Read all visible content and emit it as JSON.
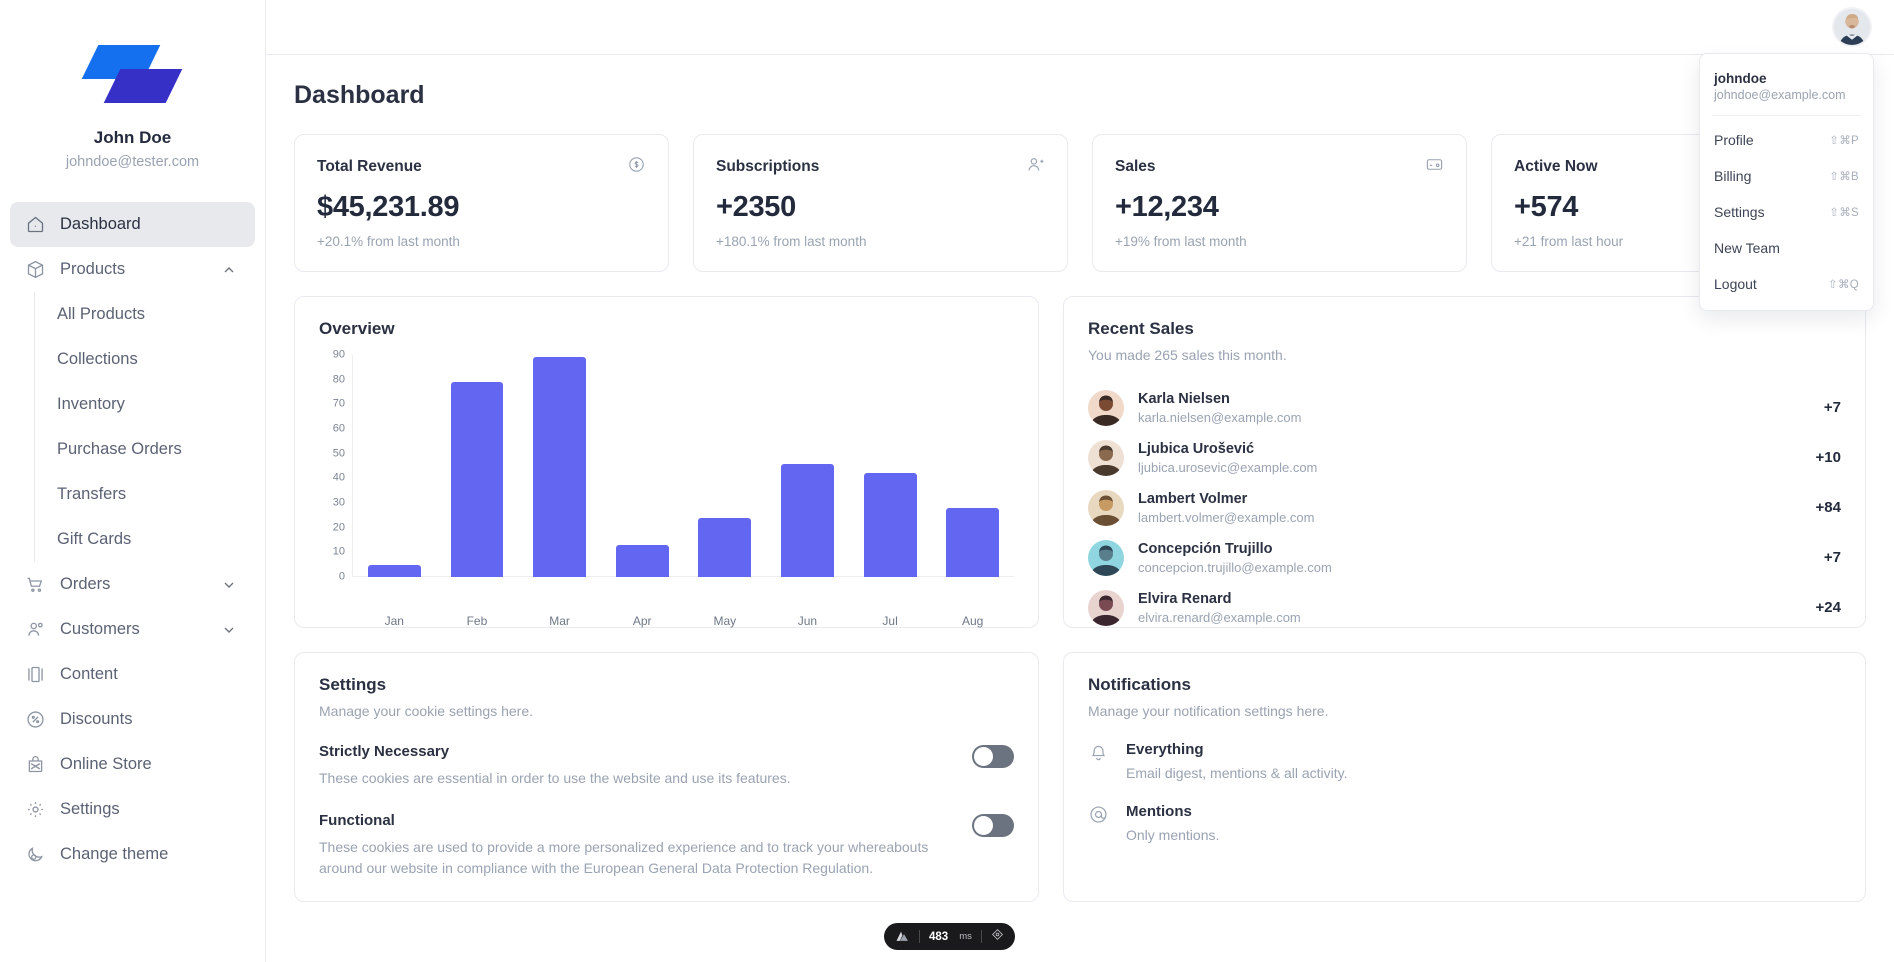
{
  "sidebar": {
    "logo_name": "app-logo",
    "profile": {
      "name": "John Doe",
      "email": "johndoe@tester.com"
    },
    "items": [
      {
        "label": "Dashboard",
        "icon": "home-icon",
        "active": true
      },
      {
        "label": "Products",
        "icon": "box-icon",
        "expanded": true
      },
      {
        "label": "Orders",
        "icon": "cart-icon",
        "expanded": false
      },
      {
        "label": "Customers",
        "icon": "users-icon",
        "expanded": false
      },
      {
        "label": "Content",
        "icon": "content-icon"
      },
      {
        "label": "Discounts",
        "icon": "discount-icon"
      },
      {
        "label": "Online Store",
        "icon": "store-icon"
      },
      {
        "label": "Settings",
        "icon": "gear-icon"
      },
      {
        "label": "Change theme",
        "icon": "theme-icon"
      }
    ],
    "products_sub": [
      "All Products",
      "Collections",
      "Inventory",
      "Purchase Orders",
      "Transfers",
      "Gift Cards"
    ]
  },
  "header": {
    "title": "Dashboard",
    "menu_icon": "hamburger-icon",
    "avatar": "user-avatar"
  },
  "stats": [
    {
      "title": "Total Revenue",
      "value": "$45,231.89",
      "sub": "+20.1% from last month",
      "icon": "dollar-icon"
    },
    {
      "title": "Subscriptions",
      "value": "+2350",
      "sub": "+180.1% from last month",
      "icon": "user-plus-icon"
    },
    {
      "title": "Sales",
      "value": "+12,234",
      "sub": "+19% from last month",
      "icon": "credit-card-icon"
    },
    {
      "title": "Active Now",
      "value": "+574",
      "sub": "+21 from last hour",
      "icon": "activity-icon"
    }
  ],
  "overview": {
    "title": "Overview"
  },
  "chart_data": {
    "type": "bar",
    "title": "Overview",
    "categories": [
      "Jan",
      "Feb",
      "Mar",
      "Apr",
      "May",
      "Jun",
      "Jul",
      "Aug"
    ],
    "values": [
      5,
      79,
      89,
      13,
      24,
      46,
      42,
      28
    ],
    "xlabel": "",
    "ylabel": "",
    "ylim": [
      0,
      90
    ],
    "yticks": [
      90,
      80,
      70,
      60,
      50,
      40,
      30,
      20,
      10,
      0
    ],
    "grid": false,
    "legend": false,
    "bar_color": "#6366f1"
  },
  "recent_sales": {
    "title": "Recent Sales",
    "subtitle": "You made 265 sales this month.",
    "rows": [
      {
        "name": "Karla Nielsen",
        "email": "karla.nielsen@example.com",
        "amount": "+7"
      },
      {
        "name": "Ljubica Urošević",
        "email": "ljubica.urosevic@example.com",
        "amount": "+10"
      },
      {
        "name": "Lambert Volmer",
        "email": "lambert.volmer@example.com",
        "amount": "+84"
      },
      {
        "name": "Concepción Trujillo",
        "email": "concepcion.trujillo@example.com",
        "amount": "+7"
      },
      {
        "name": "Elvira Renard",
        "email": "elvira.renard@example.com",
        "amount": "+24"
      }
    ]
  },
  "settings_panel": {
    "title": "Settings",
    "subtitle": "Manage your cookie settings here.",
    "items": [
      {
        "name": "Strictly Necessary",
        "desc": "These cookies are essential in order to use the website and use its features.",
        "enabled": false
      },
      {
        "name": "Functional",
        "desc": "These cookies are used to provide a more personalized experience and to track your whereabouts around our website in compliance with the European General Data Protection Regulation.",
        "enabled": false
      }
    ]
  },
  "notifications_panel": {
    "title": "Notifications",
    "subtitle": "Manage your notification settings here.",
    "items": [
      {
        "name": "Everything",
        "desc": "Email digest, mentions & all activity.",
        "icon": "bell-icon"
      },
      {
        "name": "Mentions",
        "desc": "Only mentions.",
        "icon": "at-icon"
      }
    ]
  },
  "dropdown": {
    "username": "johndoe",
    "email": "johndoe@example.com",
    "items": [
      {
        "label": "Profile",
        "shortcut": "⇧⌘P"
      },
      {
        "label": "Billing",
        "shortcut": "⇧⌘B"
      },
      {
        "label": "Settings",
        "shortcut": "⇧⌘S"
      },
      {
        "label": "New Team",
        "shortcut": ""
      },
      {
        "label": "Logout",
        "shortcut": "⇧⌘Q"
      }
    ]
  },
  "perf_badge": {
    "time": "483",
    "unit": "ms",
    "logo": "nuxt-logo-icon",
    "action_icon": "target-icon"
  },
  "colors": {
    "accent": "#6366f1",
    "logo_blue": "#1570ef",
    "logo_indigo": "#3730c7",
    "text": "#2b3142",
    "muted": "#9aa3b2"
  }
}
